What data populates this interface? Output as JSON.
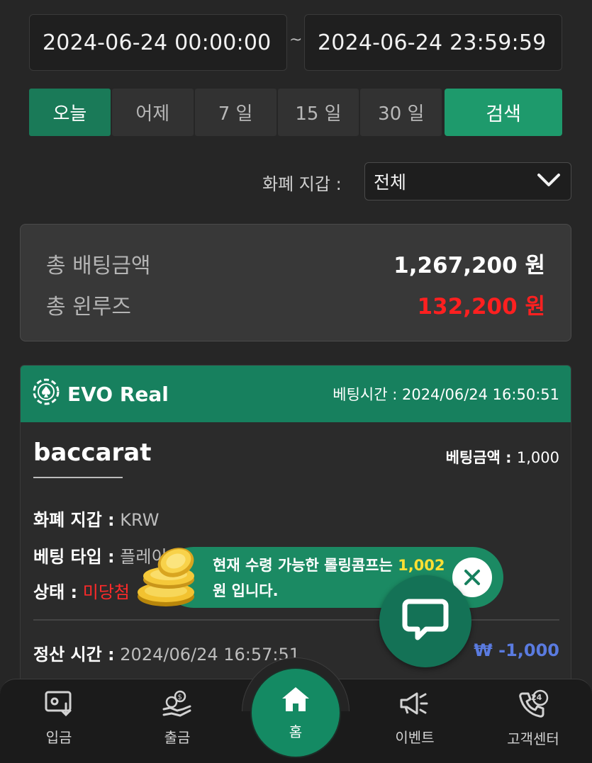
{
  "filters": {
    "date_start": "2024-06-24 00:00:00",
    "separator": "~",
    "date_end": "2024-06-24 23:59:59",
    "periods": [
      "오늘",
      "어제",
      "7 일",
      "15 일",
      "30 일"
    ],
    "active_period": "오늘",
    "search_label": "검색",
    "wallet_label": "화폐 지갑 :",
    "wallet_value": "전체"
  },
  "summary": {
    "total_bet_label": "총 배팅금액",
    "total_bet_value": "1,267,200 원",
    "total_winloss_label": "총 윈루즈",
    "total_winloss_value": "132,200 원"
  },
  "bet_card": {
    "provider": "EVO Real",
    "bet_time_label": "베팅시간 :",
    "bet_time": "2024/06/24 16:50:51",
    "game": "baccarat",
    "bet_amount_label": "베팅금액 :",
    "bet_amount": "1,000",
    "currency_label": "화폐 지갑 :",
    "currency_value": "KRW",
    "bet_type_label": "베팅 타입 :",
    "bet_type_value": "플레이어(Player)",
    "status_label": "상태 :",
    "status_value": "미당첨",
    "settle_label": "정산 시간 :",
    "settle_time": "2024/06/24 16:57:51",
    "settle_amount": "₩ -1,000"
  },
  "toast": {
    "line1_prefix": "현재 수령 가능한 롤링콤프는",
    "amount": "1,002",
    "line2": "원 입니다."
  },
  "nav": {
    "deposit": "입금",
    "withdraw": "출금",
    "home": "홈",
    "event": "이벤트",
    "support": "고객센터",
    "support_badge": "24"
  },
  "colors": {
    "accent": "#1e9a6c",
    "header_green": "#17805e",
    "loss_red": "#ff2020",
    "settle_blue": "#5a7be0",
    "highlight_yellow": "#ffe033"
  }
}
